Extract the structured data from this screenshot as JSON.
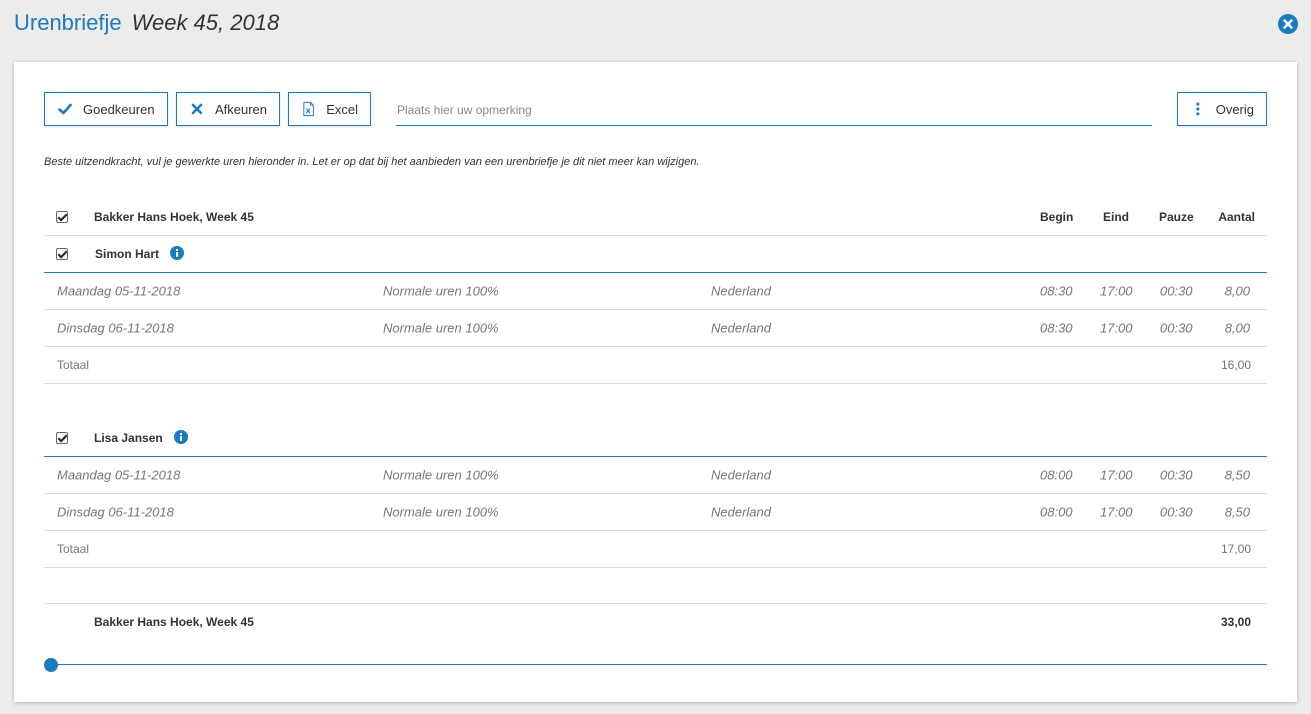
{
  "header": {
    "app_title": "Urenbriefje",
    "week_title": "Week 45, 2018"
  },
  "toolbar": {
    "approve_label": "Goedkeuren",
    "reject_label": "Afkeuren",
    "excel_label": "Excel",
    "remark_placeholder": "Plaats hier uw opmerking",
    "remark_value": "",
    "other_label": "Overig"
  },
  "intro": "Beste uitzendkracht, vul je gewerkte uren hieronder in. Let er op dat bij het aanbieden van een urenbriefje je dit niet meer kan wijzigen.",
  "group": {
    "title": "Bakker Hans Hoek, Week 45",
    "columns": {
      "begin": "Begin",
      "end": "Eind",
      "pause": "Pauze",
      "count": "Aantal"
    },
    "footer_title": "Bakker Hans Hoek, Week 45",
    "footer_total": "33,00"
  },
  "employees": [
    {
      "name": "Simon Hart",
      "rows": [
        {
          "day": "Maandag 05-11-2018",
          "type": "Normale uren 100%",
          "country": "Nederland",
          "begin": "08:30",
          "end": "17:00",
          "pause": "00:30",
          "count": "8,00"
        },
        {
          "day": "Dinsdag 06-11-2018",
          "type": "Normale uren 100%",
          "country": "Nederland",
          "begin": "08:30",
          "end": "17:00",
          "pause": "00:30",
          "count": "8,00"
        }
      ],
      "total_label": "Totaal",
      "total": "16,00"
    },
    {
      "name": "Lisa Jansen",
      "rows": [
        {
          "day": "Maandag 05-11-2018",
          "type": "Normale uren 100%",
          "country": "Nederland",
          "begin": "08:00",
          "end": "17:00",
          "pause": "00:30",
          "count": "8,50"
        },
        {
          "day": "Dinsdag 06-11-2018",
          "type": "Normale uren 100%",
          "country": "Nederland",
          "begin": "08:00",
          "end": "17:00",
          "pause": "00:30",
          "count": "8,50"
        }
      ],
      "total_label": "Totaal",
      "total": "17,00"
    }
  ],
  "slider": {
    "value": 0
  },
  "colors": {
    "accent": "#1a7bbd",
    "background": "#ececec"
  }
}
